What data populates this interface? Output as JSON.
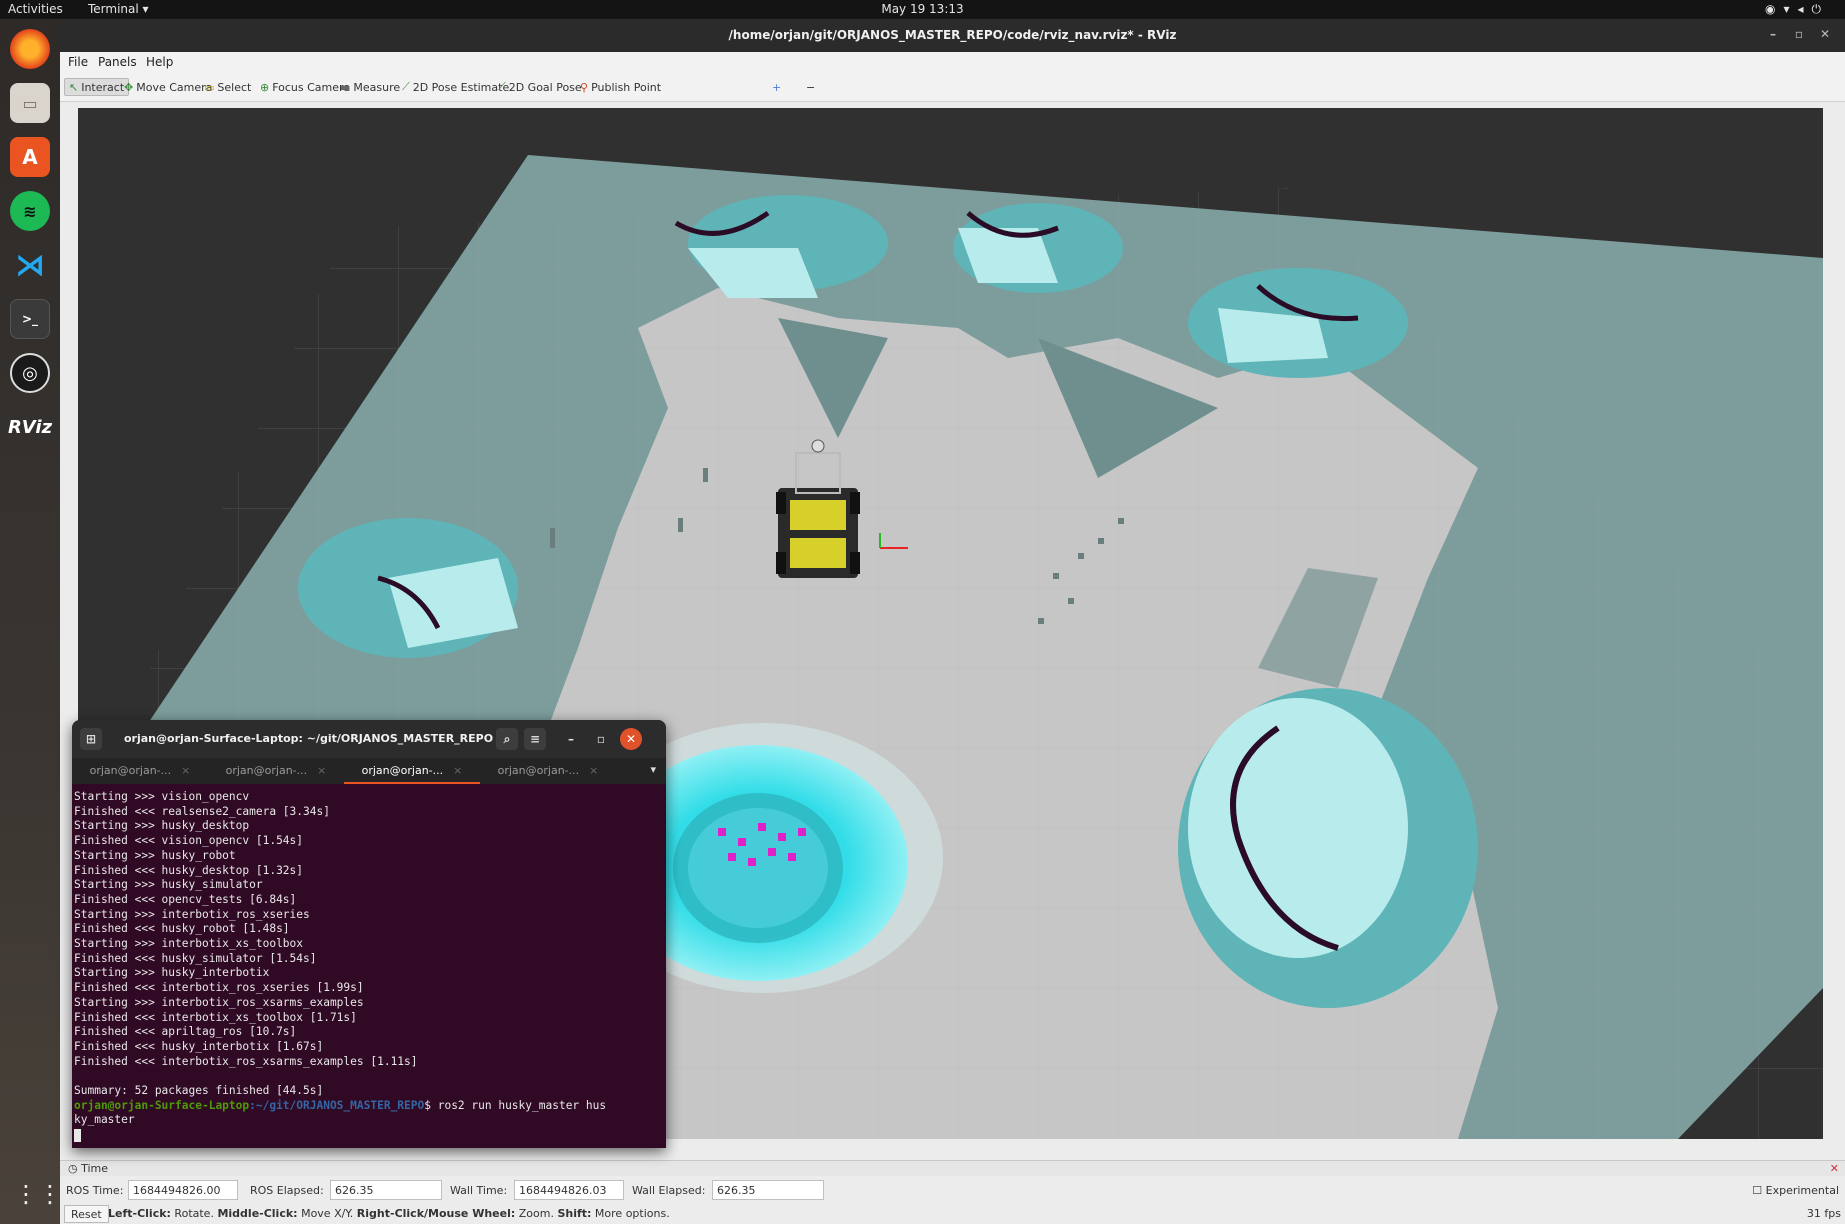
{
  "topbar": {
    "activities": "Activities",
    "app_menu": "Terminal ▾",
    "clock": "May 19  13:13",
    "tray_icons": [
      "chrome-icon",
      "wifi-icon",
      "volume-icon",
      "power-icon"
    ]
  },
  "dock": {
    "apps": [
      "firefox",
      "files",
      "software",
      "spotify",
      "vscode",
      "terminal",
      "obs",
      "rviz"
    ],
    "rviz_label": "RViz"
  },
  "window": {
    "title": "/home/orjan/git/ORJANOS_MASTER_REPO/code/rviz_nav.rviz* - RViz",
    "menu": [
      "File",
      "Panels",
      "Help"
    ],
    "tools": [
      {
        "label": "Interact",
        "active": true
      },
      {
        "label": "Move Camera",
        "active": false
      },
      {
        "label": "Select",
        "active": false
      },
      {
        "label": "Focus Camera",
        "active": false
      },
      {
        "label": "Measure",
        "active": false
      },
      {
        "label": "2D Pose Estimate",
        "active": false
      },
      {
        "label": "2D Goal Pose",
        "active": false
      },
      {
        "label": "Publish Point",
        "active": false
      }
    ],
    "tool_add": "+",
    "tool_remove": "−"
  },
  "time_panel": {
    "title": "Time",
    "ros_time_label": "ROS Time:",
    "ros_time": "1684494826.00",
    "ros_elapsed_label": "ROS Elapsed:",
    "ros_elapsed": "626.35",
    "wall_time_label": "Wall Time:",
    "wall_time": "1684494826.03",
    "wall_elapsed_label": "Wall Elapsed:",
    "wall_elapsed": "626.35",
    "experimental": "Experimental"
  },
  "status": {
    "reset": "Reset",
    "hint_left": "Left-Click:",
    "hint_left_v": " Rotate. ",
    "hint_mid": "Middle-Click:",
    "hint_mid_v": " Move X/Y. ",
    "hint_right": "Right-Click/Mouse Wheel:",
    "hint_right_v": " Zoom. ",
    "hint_shift": "Shift:",
    "hint_shift_v": " More options.",
    "fps": "31 fps"
  },
  "terminal": {
    "title": "orjan@orjan-Surface-Laptop: ~/git/ORJANOS_MASTER_REPO",
    "tabs": [
      "orjan@orjan-...",
      "orjan@orjan-...",
      "orjan@orjan-...",
      "orjan@orjan-..."
    ],
    "active_tab": 2,
    "lines": [
      "Starting >>> vision_opencv",
      "Finished <<< realsense2_camera [3.34s]",
      "Starting >>> husky_desktop",
      "Finished <<< vision_opencv [1.54s]",
      "Starting >>> husky_robot",
      "Finished <<< husky_desktop [1.32s]",
      "Starting >>> husky_simulator",
      "Finished <<< opencv_tests [6.84s]",
      "Starting >>> interbotix_ros_xseries",
      "Finished <<< husky_robot [1.48s]",
      "Starting >>> interbotix_xs_toolbox",
      "Finished <<< husky_simulator [1.54s]",
      "Starting >>> husky_interbotix",
      "Finished <<< interbotix_ros_xseries [1.99s]",
      "Starting >>> interbotix_ros_xsarms_examples",
      "Finished <<< interbotix_xs_toolbox [1.71s]",
      "Finished <<< apriltag_ros [10.7s]",
      "Finished <<< husky_interbotix [1.67s]",
      "Finished <<< interbotix_ros_xsarms_examples [1.11s]",
      "",
      "Summary: 52 packages finished [44.5s]"
    ],
    "prompt_user": "orjan@orjan-Surface-Laptop",
    "prompt_path": ":~/git/ORJANOS_MASTER_REPO",
    "command": "$ ros2 run husky_master hus",
    "command_wrap": "ky_master"
  },
  "colors": {
    "map_free": "#c8c8c8",
    "map_unknown": "#7a9a9a",
    "inflation": "#5fb4b8",
    "inflation_light": "#b8ecec",
    "obstacle": "#3a1030",
    "local_costmap": "#3de3ef",
    "robot_body": "#d8d02a"
  }
}
